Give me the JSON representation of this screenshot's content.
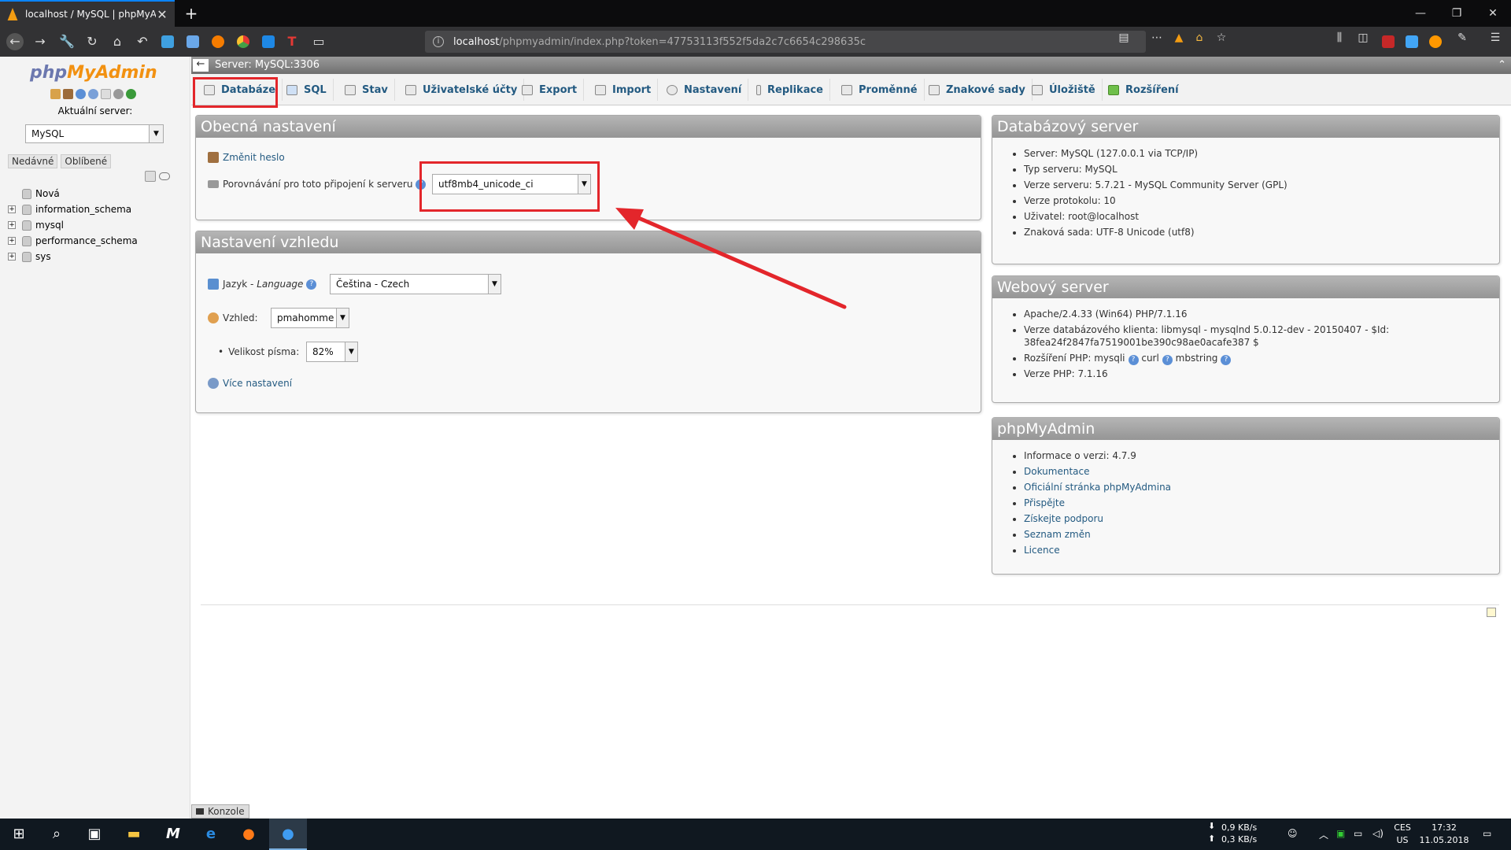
{
  "browser": {
    "tab_title": "localhost / MySQL | phpMyAdmin",
    "url_host": "localhost",
    "url_path": "/phpmyadmin/index.php?token=47753113f552f5da2c7c6654c298635c",
    "new_tab": "+",
    "close": "✕"
  },
  "nav": {
    "logo_php": "php",
    "logo_myadmin": "MyAdmin",
    "current_server_label": "Aktuální server:",
    "current_server_value": "MySQL",
    "recent": "Nedávné",
    "favorites": "Oblíbené",
    "databases": [
      {
        "name": "Nová"
      },
      {
        "name": "information_schema"
      },
      {
        "name": "mysql"
      },
      {
        "name": "performance_schema"
      },
      {
        "name": "sys"
      }
    ]
  },
  "server_bar": {
    "label": "Server: MySQL:3306"
  },
  "menu": {
    "tabs": [
      {
        "label": "Databáze"
      },
      {
        "label": "SQL"
      },
      {
        "label": "Stav"
      },
      {
        "label": "Uživatelské účty"
      },
      {
        "label": "Export"
      },
      {
        "label": "Import"
      },
      {
        "label": "Nastavení"
      },
      {
        "label": "Replikace"
      },
      {
        "label": "Proměnné"
      },
      {
        "label": "Znakové sady"
      },
      {
        "label": "Úložiště"
      },
      {
        "label": "Rozšíření"
      }
    ]
  },
  "general": {
    "title": "Obecná nastavení",
    "change_password": "Změnit heslo",
    "collation_label": "Porovnávání pro toto připojení k serveru",
    "collation_value": "utf8mb4_unicode_ci"
  },
  "appearance": {
    "title": "Nastavení vzhledu",
    "language_label": "Jazyk - ",
    "language_label_italic": "Language",
    "language_value": "Čeština - Czech",
    "theme_label": "Vzhled:",
    "theme_value": "pmahomme",
    "fontsize_label": "Velikost písma:",
    "fontsize_value": "82%",
    "more_settings": "Více nastavení"
  },
  "db_server": {
    "title": "Databázový server",
    "items": [
      "Server: MySQL (127.0.0.1 via TCP/IP)",
      "Typ serveru: MySQL",
      "Verze serveru: 5.7.21 - MySQL Community Server (GPL)",
      "Verze protokolu: 10",
      "Uživatel: root@localhost",
      "Znaková sada: UTF-8 Unicode (utf8)"
    ]
  },
  "web_server": {
    "title": "Webový server",
    "apache": "Apache/2.4.33 (Win64) PHP/7.1.16",
    "client_version_line1": "Verze databázového klienta: libmysql - mysqlnd 5.0.12-dev - 20150407 - $Id:",
    "client_version_line2": "38fea24f2847fa7519001be390c98ae0acafe387 $",
    "php_ext_label": "Rozšíření PHP: ",
    "php_ext_1": "mysqli",
    "php_ext_2": "curl",
    "php_ext_3": "mbstring",
    "php_version": "Verze PHP: 7.1.16"
  },
  "pma": {
    "title": "phpMyAdmin",
    "version": "Informace o verzi: 4.7.9",
    "links": [
      "Dokumentace",
      "Oficiální stránka phpMyAdmina",
      "Přispějte",
      "Získejte podporu",
      "Seznam změn",
      "Licence"
    ]
  },
  "console": {
    "label": "Konzole"
  },
  "taskbar": {
    "down_speed": "0,9 KB/s",
    "up_speed": "0,3 KB/s",
    "lang_1": "CES",
    "lang_2": "US",
    "time": "17:32",
    "date": "11.05.2018"
  },
  "colors": {
    "highlight": "#e3262b",
    "link": "#235a81",
    "panel_header": "#a5a5a5"
  }
}
